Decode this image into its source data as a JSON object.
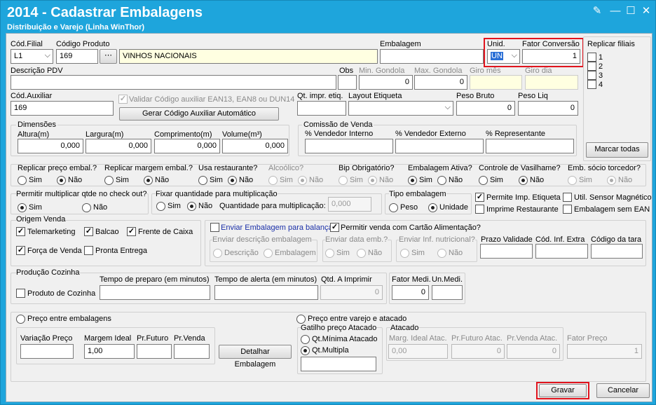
{
  "window": {
    "title": "2014 - Cadastrar Embalagens",
    "subtitle": "Distribuição e Varejo (Linha WinThor)"
  },
  "produto": {
    "cod_filial_label": "Cód.Filial",
    "cod_filial_value": "L1",
    "codigo_label": "Código Produto",
    "codigo_value": "169",
    "descricao_value": "VINHOS NACIONAIS"
  },
  "embalagem": {
    "label": "Embalagem",
    "value": "",
    "unid_label": "Unid.",
    "unid_value": "UN",
    "fator_label": "Fator Conversão",
    "fator_value": "1"
  },
  "replicar_filiais": {
    "label": "Replicar filiais",
    "items": [
      "1",
      "2",
      "3",
      "4"
    ],
    "marcar_todas": "Marcar todas"
  },
  "pdv": {
    "descricao_label": "Descrição PDV",
    "descricao_value": "",
    "obs_label": "Obs",
    "min_label": "Min. Gondola",
    "min_value": "0",
    "max_label": "Max. Gondola",
    "max_value": "0",
    "giro_mes_label": "Giro mês",
    "giro_dia_label": "Giro dia"
  },
  "auxiliar": {
    "label": "Cód.Auxiliar",
    "value": "169",
    "validar_label": "Validar Código auxiliar EAN13, EAN8 ou DUN14",
    "gerar_button": "Gerar Código Auxiliar Automático"
  },
  "etiqueta": {
    "qt_label": "Qt. impr. etiq.",
    "layout_label": "Layout Etiqueta",
    "peso_bruto_label": "Peso Bruto",
    "peso_bruto_value": "0",
    "peso_liq_label": "Peso Liq",
    "peso_liq_value": "0"
  },
  "dimensoes": {
    "label": "Dimensões",
    "altura_label": "Altura(m)",
    "altura_value": "0,000",
    "largura_label": "Largura(m)",
    "largura_value": "0,000",
    "comprimento_label": "Comprimento(m)",
    "comprimento_value": "0,000",
    "volume_label": "Volume(m³)",
    "volume_value": "0,000"
  },
  "comissao": {
    "label": "Comissão de Venda",
    "interno_label": "% Vendedor Interno",
    "externo_label": "% Vendedor Externo",
    "rep_label": "% Representante"
  },
  "options": {
    "sim": "Sim",
    "nao": "Não",
    "replicar_preco": "Replicar preço embal.?",
    "replicar_margem": "Replicar margem embal.?",
    "usa_restaurante": "Usa restaurante?",
    "alcoolico": "Alcoólico?",
    "bip": "Bip Obrigatório?",
    "embalagem_ativa": "Embalagem Ativa?",
    "vasilhame": "Controle de Vasilhame?",
    "socio": "Emb. sócio torcedor?",
    "permitir_mult": "Permitir multiplicar qtde no check out?",
    "fixar_qtd": "Fixar quantidade para multiplicação",
    "qtd_mult_label": "Quantidade para multiplicação:",
    "qtd_mult_value": "0,000",
    "tipo_emb": "Tipo embalagem",
    "peso": "Peso",
    "unidade": "Unidade",
    "permite_imp": "Permite Imp. Etiqueta",
    "util_sensor": "Util. Sensor Magnético",
    "imprime_rest": "Imprime Restaurante",
    "sem_ean": "Embalagem sem EAN"
  },
  "origem": {
    "label": "Origem Venda",
    "telemarketing": "Telemarketing",
    "balcao": "Balcao",
    "frente": "Frente de Caixa",
    "forca": "Força de Venda",
    "pronta": "Pronta Entrega"
  },
  "balanca": {
    "enviar_label": "Enviar Embalagem para balança",
    "cartao_label": "Permitir venda com Cartão Alimentação?",
    "enviar_desc": "Enviar descrição embalagem",
    "descricao": "Descrição",
    "embalagem": "Embalagem",
    "enviar_data": "Enviar data emb.?",
    "enviar_inf": "Enviar Inf. nutricional?",
    "prazo_label": "Prazo Validade",
    "inf_extra_label": "Cód. Inf. Extra",
    "tara_label": "Código da tara"
  },
  "cozinha": {
    "label": "Produção Cozinha",
    "produto_label": "Produto de Cozinha",
    "preparo_label": "Tempo de preparo (em minutos)",
    "alerta_label": "Tempo de alerta (em minutos)",
    "qtd_label": "Qtd. A Imprimir",
    "qtd_value": "0",
    "fator_medi_label": "Fator Medi.",
    "fator_medi_value": "0",
    "un_medi_label": "Un.Medi."
  },
  "preco": {
    "entre_emb": "Preço entre embalagens",
    "variacao_label": "Variação Preço",
    "margem_label": "Margem Ideal",
    "margem_value": "1,00",
    "futuro_label": "Pr.Futuro",
    "venda_label": "Pr.Venda",
    "detalhar_button": "Detalhar Embalagem",
    "varejo_atacado": "Preço entre varejo e atacado",
    "gatilho_label": "Gatilho preço Atacado",
    "qt_minima": "Qt.Mínima Atacado",
    "qt_multipla": "Qt.Multipla",
    "atacado_label": "Atacado",
    "marg_atac_label": "Marg. Ideal Atac.",
    "marg_atac_value": "0,00",
    "futuro_atac_label": "Pr.Futuro Atac.",
    "futuro_atac_value": "0",
    "venda_atac_label": "Pr.Venda Atac.",
    "venda_atac_value": "0",
    "fator_preco_label": "Fator Preço",
    "fator_preco_value": "1"
  },
  "footer": {
    "gravar": "Gravar",
    "cancelar": "Cancelar"
  }
}
